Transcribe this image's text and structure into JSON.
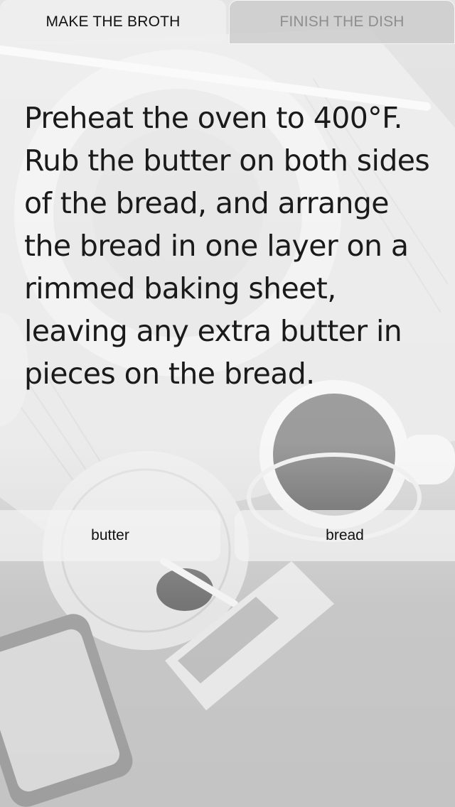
{
  "tabs": [
    {
      "label": "MAKE THE BROTH",
      "active": true
    },
    {
      "label": "FINISH THE DISH",
      "active": false
    }
  ],
  "step": {
    "text": "Preheat the oven to 400°F. Rub the butter on both sides of the bread, and arrange the bread in one layer on a rimmed baking sheet, leaving any extra butter in pieces on the bread."
  },
  "ingredients": [
    {
      "label": "butter"
    },
    {
      "label": "bread"
    }
  ],
  "colors": {
    "tab_active_bg": "#eeeeee",
    "tab_inactive_text": "#8e8e8e",
    "text": "#1a1a1a"
  }
}
